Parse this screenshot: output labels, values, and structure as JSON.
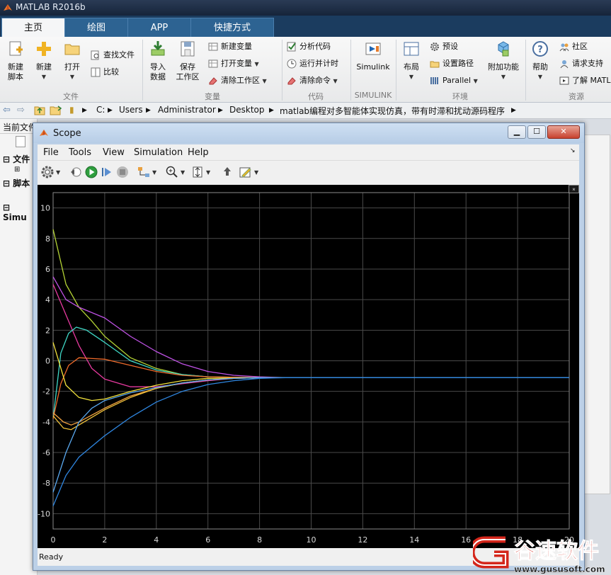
{
  "app": {
    "title": "MATLAB R2016b"
  },
  "tabs": [
    {
      "label": "主页",
      "active": true
    },
    {
      "label": "绘图",
      "active": false
    },
    {
      "label": "APP",
      "active": false
    },
    {
      "label": "快捷方式",
      "active": false
    }
  ],
  "ribbon": {
    "file": {
      "group_label": "文件",
      "new_script": "新建\n脚本",
      "new": "新建",
      "open": "打开",
      "find_files": "查找文件",
      "compare": "比较"
    },
    "variable": {
      "group_label": "变量",
      "import": "导入\n数据",
      "save_ws": "保存\n工作区",
      "new_var": "新建变量",
      "open_var": "打开变量",
      "clear_ws": "清除工作区"
    },
    "code": {
      "group_label": "代码",
      "analyze": "分析代码",
      "run_time": "运行并计时",
      "clear_cmd": "清除命令"
    },
    "simulink": {
      "group_label": "SIMULINK",
      "simulink": "Simulink"
    },
    "environment": {
      "group_label": "环境",
      "layout": "布局",
      "prefs": "预设",
      "set_path": "设置路径",
      "parallel": "Parallel",
      "addons": "附加功能"
    },
    "resources": {
      "group_label": "资源",
      "help": "帮助",
      "community": "社区",
      "support": "请求支持",
      "learn": "了解 MATL"
    }
  },
  "address": {
    "segments": [
      "C:",
      "Users",
      "Administrator",
      "Desktop",
      "matlab编程对多智能体实现仿真，带有时滞和扰动源码程序"
    ]
  },
  "left_panel": {
    "header": "当前文件夹",
    "sections": [
      "文件",
      "脚本",
      "Simu"
    ]
  },
  "scope": {
    "title": "Scope",
    "menu": [
      "File",
      "Tools",
      "View",
      "Simulation",
      "Help"
    ],
    "status": "Ready",
    "colors": {
      "bg": "#000000",
      "grid": "#4a4a4a",
      "ticks": "#d9d9d9"
    }
  },
  "chart_data": {
    "type": "line",
    "title": "",
    "xlabel": "",
    "ylabel": "",
    "xlim": [
      0,
      20
    ],
    "ylim": [
      -11,
      11
    ],
    "x_ticks": [
      0,
      2,
      4,
      6,
      8,
      10,
      12,
      14,
      16,
      18,
      20
    ],
    "y_ticks": [
      10,
      8,
      6,
      4,
      2,
      0,
      -2,
      -4,
      -6,
      -8,
      -10
    ],
    "grid": true,
    "series": [
      {
        "color": "#b4d335",
        "points": [
          [
            0,
            8.6
          ],
          [
            0.5,
            5.0
          ],
          [
            1,
            3.5
          ],
          [
            1.5,
            2.6
          ],
          [
            2,
            1.6
          ],
          [
            3,
            0.2
          ],
          [
            4,
            -0.5
          ],
          [
            5,
            -0.9
          ],
          [
            6,
            -1.05
          ],
          [
            8,
            -1.1
          ],
          [
            20,
            -1.1
          ]
        ]
      },
      {
        "color": "#c052e6",
        "points": [
          [
            0,
            5.5
          ],
          [
            0.5,
            4.0
          ],
          [
            1,
            3.5
          ],
          [
            2,
            2.8
          ],
          [
            3,
            1.6
          ],
          [
            4,
            0.6
          ],
          [
            5,
            -0.2
          ],
          [
            6,
            -0.7
          ],
          [
            7,
            -0.95
          ],
          [
            8,
            -1.05
          ],
          [
            9,
            -1.1
          ],
          [
            20,
            -1.1
          ]
        ]
      },
      {
        "color": "#e83aa0",
        "points": [
          [
            0,
            5.0
          ],
          [
            0.5,
            3.0
          ],
          [
            1,
            1.0
          ],
          [
            1.5,
            -0.5
          ],
          [
            2,
            -1.2
          ],
          [
            3,
            -1.7
          ],
          [
            4,
            -1.7
          ],
          [
            5,
            -1.5
          ],
          [
            6,
            -1.3
          ],
          [
            7,
            -1.15
          ],
          [
            8,
            -1.1
          ],
          [
            20,
            -1.1
          ]
        ]
      },
      {
        "color": "#3fd8c6",
        "points": [
          [
            0,
            -3.8
          ],
          [
            0.3,
            0.5
          ],
          [
            0.6,
            1.8
          ],
          [
            0.9,
            2.2
          ],
          [
            1.3,
            2.0
          ],
          [
            2,
            1.2
          ],
          [
            3,
            0.0
          ],
          [
            4,
            -0.6
          ],
          [
            5,
            -0.9
          ],
          [
            6,
            -1.05
          ],
          [
            8,
            -1.1
          ],
          [
            20,
            -1.1
          ]
        ]
      },
      {
        "color": "#ee6a2a",
        "points": [
          [
            0,
            -3.8
          ],
          [
            0.3,
            -1.5
          ],
          [
            0.6,
            -0.3
          ],
          [
            1,
            0.2
          ],
          [
            2,
            0.1
          ],
          [
            3,
            -0.3
          ],
          [
            4,
            -0.7
          ],
          [
            5,
            -0.95
          ],
          [
            6,
            -1.05
          ],
          [
            8,
            -1.1
          ],
          [
            20,
            -1.1
          ]
        ]
      },
      {
        "color": "#f2e23c",
        "points": [
          [
            0,
            1.2
          ],
          [
            0.5,
            -1.6
          ],
          [
            1,
            -2.4
          ],
          [
            1.5,
            -2.6
          ],
          [
            2,
            -2.5
          ],
          [
            3,
            -2.0
          ],
          [
            4,
            -1.6
          ],
          [
            5,
            -1.3
          ],
          [
            6,
            -1.15
          ],
          [
            8,
            -1.1
          ],
          [
            20,
            -1.1
          ]
        ]
      },
      {
        "color": "#f4a340",
        "points": [
          [
            0,
            -3.4
          ],
          [
            0.4,
            -4.0
          ],
          [
            0.7,
            -4.2
          ],
          [
            1,
            -4.0
          ],
          [
            2,
            -3.1
          ],
          [
            3,
            -2.3
          ],
          [
            4,
            -1.8
          ],
          [
            5,
            -1.45
          ],
          [
            6,
            -1.25
          ],
          [
            7,
            -1.15
          ],
          [
            8,
            -1.1
          ],
          [
            20,
            -1.1
          ]
        ]
      },
      {
        "color": "#f0c23a",
        "points": [
          [
            0,
            -3.6
          ],
          [
            0.4,
            -4.4
          ],
          [
            0.7,
            -4.5
          ],
          [
            1,
            -4.2
          ],
          [
            2,
            -3.2
          ],
          [
            3,
            -2.4
          ],
          [
            4,
            -1.8
          ],
          [
            5,
            -1.45
          ],
          [
            6,
            -1.25
          ],
          [
            7,
            -1.15
          ],
          [
            8,
            -1.1
          ],
          [
            20,
            -1.1
          ]
        ]
      },
      {
        "color": "#5aa8ef",
        "points": [
          [
            0,
            -8.6
          ],
          [
            0.5,
            -6.0
          ],
          [
            1,
            -4.0
          ],
          [
            1.5,
            -3.1
          ],
          [
            2,
            -2.6
          ],
          [
            3,
            -2.1
          ],
          [
            4,
            -1.75
          ],
          [
            5,
            -1.45
          ],
          [
            6,
            -1.25
          ],
          [
            7,
            -1.15
          ],
          [
            8,
            -1.1
          ],
          [
            20,
            -1.1
          ]
        ]
      },
      {
        "color": "#2f86e0",
        "points": [
          [
            0,
            -9.5
          ],
          [
            0.5,
            -7.5
          ],
          [
            1,
            -6.3
          ],
          [
            2,
            -4.9
          ],
          [
            3,
            -3.7
          ],
          [
            4,
            -2.7
          ],
          [
            5,
            -2.0
          ],
          [
            6,
            -1.55
          ],
          [
            7,
            -1.3
          ],
          [
            8,
            -1.15
          ],
          [
            9,
            -1.1
          ],
          [
            20,
            -1.1
          ]
        ]
      }
    ]
  },
  "watermark": {
    "brand": "谷速软件",
    "url": "www.gususoft.com"
  }
}
